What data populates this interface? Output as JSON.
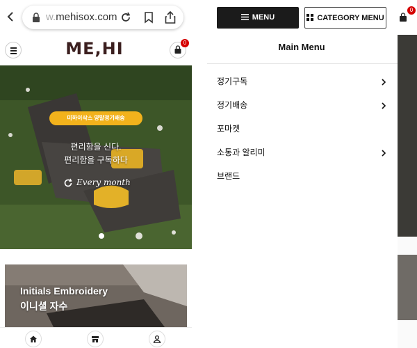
{
  "browser": {
    "url_dim": "w.",
    "url_main": "mehisox.com"
  },
  "site": {
    "logo": "ME,HI",
    "cart_count": "0"
  },
  "hero": {
    "badge": "미하이삭스 양말정기배송",
    "line1": "편리함을 신다.",
    "line2": "편리함을 구독하다",
    "every": "Every month"
  },
  "promo": {
    "title": "Initials Embroidery",
    "subtitle": "이니셜 자수"
  },
  "drawer": {
    "menu_label": "MENU",
    "category_label": "CATEGORY MENU",
    "title": "Main Menu",
    "items": [
      {
        "label": "정기구독",
        "has_children": true
      },
      {
        "label": "정기배송",
        "has_children": true
      },
      {
        "label": "포마켓",
        "has_children": false
      },
      {
        "label": "소통과 알리미",
        "has_children": true
      },
      {
        "label": "브랜드",
        "has_children": false
      }
    ]
  },
  "colors": {
    "accent_badge": "#f2b21c",
    "cart_badge": "#d50000",
    "menu_button": "#1b1b1b",
    "logo": "#3b1f1f"
  },
  "icons": [
    "back-icon",
    "lock-icon",
    "reload-icon",
    "bookmark-icon",
    "share-icon",
    "hamburger-icon",
    "cart-icon",
    "refresh-icon",
    "home-icon",
    "store-icon",
    "user-icon",
    "chevron-right-icon",
    "grid-icon"
  ]
}
